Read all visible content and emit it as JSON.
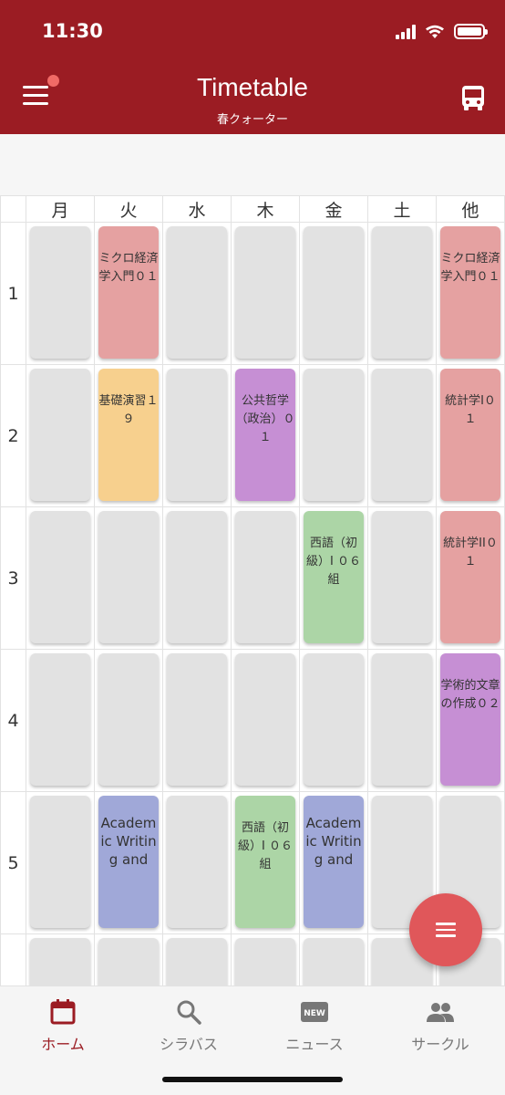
{
  "status": {
    "time": "11:30"
  },
  "header": {
    "title": "Timetable",
    "subtitle": "春クォーター"
  },
  "days": [
    "月",
    "火",
    "水",
    "木",
    "金",
    "土",
    "他"
  ],
  "periods": [
    {
      "number": "1",
      "slots": [
        {
          "text": "",
          "color": ""
        },
        {
          "text": "ミクロ経済学入門０１",
          "color": "red"
        },
        {
          "text": "",
          "color": ""
        },
        {
          "text": "",
          "color": ""
        },
        {
          "text": "",
          "color": ""
        },
        {
          "text": "",
          "color": ""
        },
        {
          "text": "ミクロ経済学入門０１",
          "color": "red"
        }
      ]
    },
    {
      "number": "2",
      "slots": [
        {
          "text": "",
          "color": ""
        },
        {
          "text": "基礎演習１９",
          "color": "orange"
        },
        {
          "text": "",
          "color": ""
        },
        {
          "text": "公共哲学（政治）０１",
          "color": "purple"
        },
        {
          "text": "",
          "color": ""
        },
        {
          "text": "",
          "color": ""
        },
        {
          "text": "統計学I０１",
          "color": "red"
        }
      ]
    },
    {
      "number": "3",
      "slots": [
        {
          "text": "",
          "color": ""
        },
        {
          "text": "",
          "color": ""
        },
        {
          "text": "",
          "color": ""
        },
        {
          "text": "",
          "color": ""
        },
        {
          "text": "西語（初級）I ０６組",
          "color": "green"
        },
        {
          "text": "",
          "color": ""
        },
        {
          "text": "統計学II０１",
          "color": "red"
        }
      ]
    },
    {
      "number": "4",
      "slots": [
        {
          "text": "",
          "color": ""
        },
        {
          "text": "",
          "color": ""
        },
        {
          "text": "",
          "color": ""
        },
        {
          "text": "",
          "color": ""
        },
        {
          "text": "",
          "color": ""
        },
        {
          "text": "",
          "color": ""
        },
        {
          "text": "学術的文章の作成０２",
          "color": "purple"
        }
      ]
    },
    {
      "number": "5",
      "slots": [
        {
          "text": "",
          "color": ""
        },
        {
          "text": "Academic Writing and",
          "color": "blue"
        },
        {
          "text": "",
          "color": ""
        },
        {
          "text": "西語（初級）I ０６組",
          "color": "green"
        },
        {
          "text": "Academic Writing and",
          "color": "blue"
        },
        {
          "text": "",
          "color": ""
        },
        {
          "text": "",
          "color": ""
        }
      ]
    },
    {
      "number": "",
      "slots": [
        {
          "text": "",
          "color": ""
        },
        {
          "text": "",
          "color": ""
        },
        {
          "text": "",
          "color": ""
        },
        {
          "text": "",
          "color": ""
        },
        {
          "text": "",
          "color": ""
        },
        {
          "text": "",
          "color": ""
        },
        {
          "text": "",
          "color": ""
        }
      ]
    }
  ],
  "bottom_nav": [
    {
      "label": "ホーム",
      "icon": "calendar-icon",
      "active": true
    },
    {
      "label": "シラバス",
      "icon": "search-icon",
      "active": false
    },
    {
      "label": "ニュース",
      "icon": "new-badge-icon",
      "active": false
    },
    {
      "label": "サークル",
      "icon": "people-icon",
      "active": false
    }
  ],
  "colors": {
    "header": "#9b1c23",
    "red": "#e5a1a1",
    "orange": "#f7d08e",
    "purple": "#c68fd4",
    "green": "#acd5a6",
    "blue": "#a0a8d8",
    "fab": "#e0575a"
  }
}
